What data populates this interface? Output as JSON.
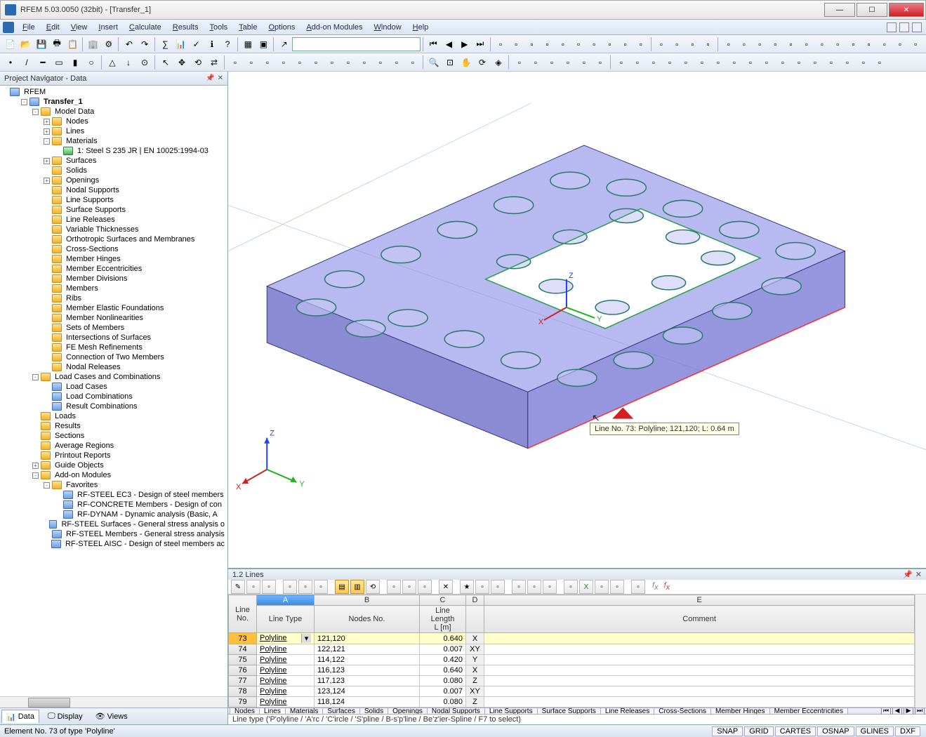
{
  "window": {
    "title": "RFEM 5.03.0050 (32bit) - [Transfer_1]"
  },
  "menu": [
    "File",
    "Edit",
    "View",
    "Insert",
    "Calculate",
    "Results",
    "Tools",
    "Table",
    "Options",
    "Add-on Modules",
    "Window",
    "Help"
  ],
  "navigator": {
    "title": "Project Navigator - Data",
    "root": "RFEM",
    "project": "Transfer_1",
    "model_data": "Model Data",
    "nodes": "Nodes",
    "lines": "Lines",
    "materials": "Materials",
    "material1": "1: Steel S 235 JR | EN 10025:1994-03",
    "surfaces": "Surfaces",
    "solids": "Solids",
    "openings": "Openings",
    "nodal_supports": "Nodal Supports",
    "line_supports": "Line Supports",
    "surface_supports": "Surface Supports",
    "line_releases": "Line Releases",
    "var_thick": "Variable Thicknesses",
    "ortho": "Orthotropic Surfaces and Membranes",
    "cross_sections": "Cross-Sections",
    "m_hinges": "Member Hinges",
    "m_ecc": "Member Eccentricities",
    "m_div": "Member Divisions",
    "members": "Members",
    "ribs": "Ribs",
    "m_ef": "Member Elastic Foundations",
    "m_nonlin": "Member Nonlinearities",
    "sets": "Sets of Members",
    "isurf": "Intersections of Surfaces",
    "fe_mesh": "FE Mesh Refinements",
    "conn2": "Connection of Two Members",
    "nodal_rel": "Nodal Releases",
    "lcc": "Load Cases and Combinations",
    "load_cases": "Load Cases",
    "load_combos": "Load Combinations",
    "result_combos": "Result Combinations",
    "loads": "Loads",
    "results": "Results",
    "sections": "Sections",
    "avg_regions": "Average Regions",
    "printout": "Printout Reports",
    "guide": "Guide Objects",
    "addon": "Add-on Modules",
    "favorites": "Favorites",
    "fav1": "RF-STEEL EC3 - Design of steel members",
    "fav2": "RF-CONCRETE Members - Design of con",
    "fav3": "RF-DYNAM - Dynamic analysis (Basic, A",
    "mod1": "RF-STEEL Surfaces - General stress analysis o",
    "mod2": "RF-STEEL Members - General stress analysis",
    "mod3": "RF-STEEL AISC - Design of steel members ac",
    "footer_tabs": {
      "data": "Data",
      "display": "Display",
      "views": "Views"
    }
  },
  "viewport": {
    "tooltip": "Line No. 73: Polyline; 121,120; L: 0.64 m",
    "axes": {
      "x": "X",
      "y": "Y",
      "z": "Z"
    }
  },
  "lines_panel": {
    "title": "1.2 Lines",
    "columns": {
      "lineno": "Line\nNo.",
      "a": "A",
      "b": "B",
      "c": "C",
      "d": "D",
      "e": "E",
      "linetype": "Line Type",
      "nodesno": "Nodes No.",
      "linelen": "Line Length\nL [m]",
      "comment": "Comment"
    },
    "rows": [
      {
        "no": "73",
        "type": "Polyline",
        "nodes": "121,120",
        "len": "0.640",
        "d": "X"
      },
      {
        "no": "74",
        "type": "Polyline",
        "nodes": "122,121",
        "len": "0.007",
        "d": "XY"
      },
      {
        "no": "75",
        "type": "Polyline",
        "nodes": "114,122",
        "len": "0.420",
        "d": "Y"
      },
      {
        "no": "76",
        "type": "Polyline",
        "nodes": "116,123",
        "len": "0.640",
        "d": "X"
      },
      {
        "no": "77",
        "type": "Polyline",
        "nodes": "117,123",
        "len": "0.080",
        "d": "Z"
      },
      {
        "no": "78",
        "type": "Polyline",
        "nodes": "123,124",
        "len": "0.007",
        "d": "XY"
      },
      {
        "no": "79",
        "type": "Polyline",
        "nodes": "118,124",
        "len": "0.080",
        "d": "Z"
      }
    ],
    "tabs": [
      "Nodes",
      "Lines",
      "Materials",
      "Surfaces",
      "Solids",
      "Openings",
      "Nodal Supports",
      "Line Supports",
      "Surface Supports",
      "Line Releases",
      "Cross-Sections",
      "Member Hinges",
      "Member Eccentricities"
    ],
    "hint": "Line type ('P'olyline / 'A'rc / 'C'ircle / 'S'pline / B-s'p'line / Be'z'ier-Spline / F7 to select)"
  },
  "statusbar": {
    "left": "Element No. 73 of type 'Polyline'",
    "snap": "SNAP",
    "grid": "GRID",
    "cartes": "CARTES",
    "osnap": "OSNAP",
    "glines": "GLINES",
    "dxf": "DXF"
  }
}
